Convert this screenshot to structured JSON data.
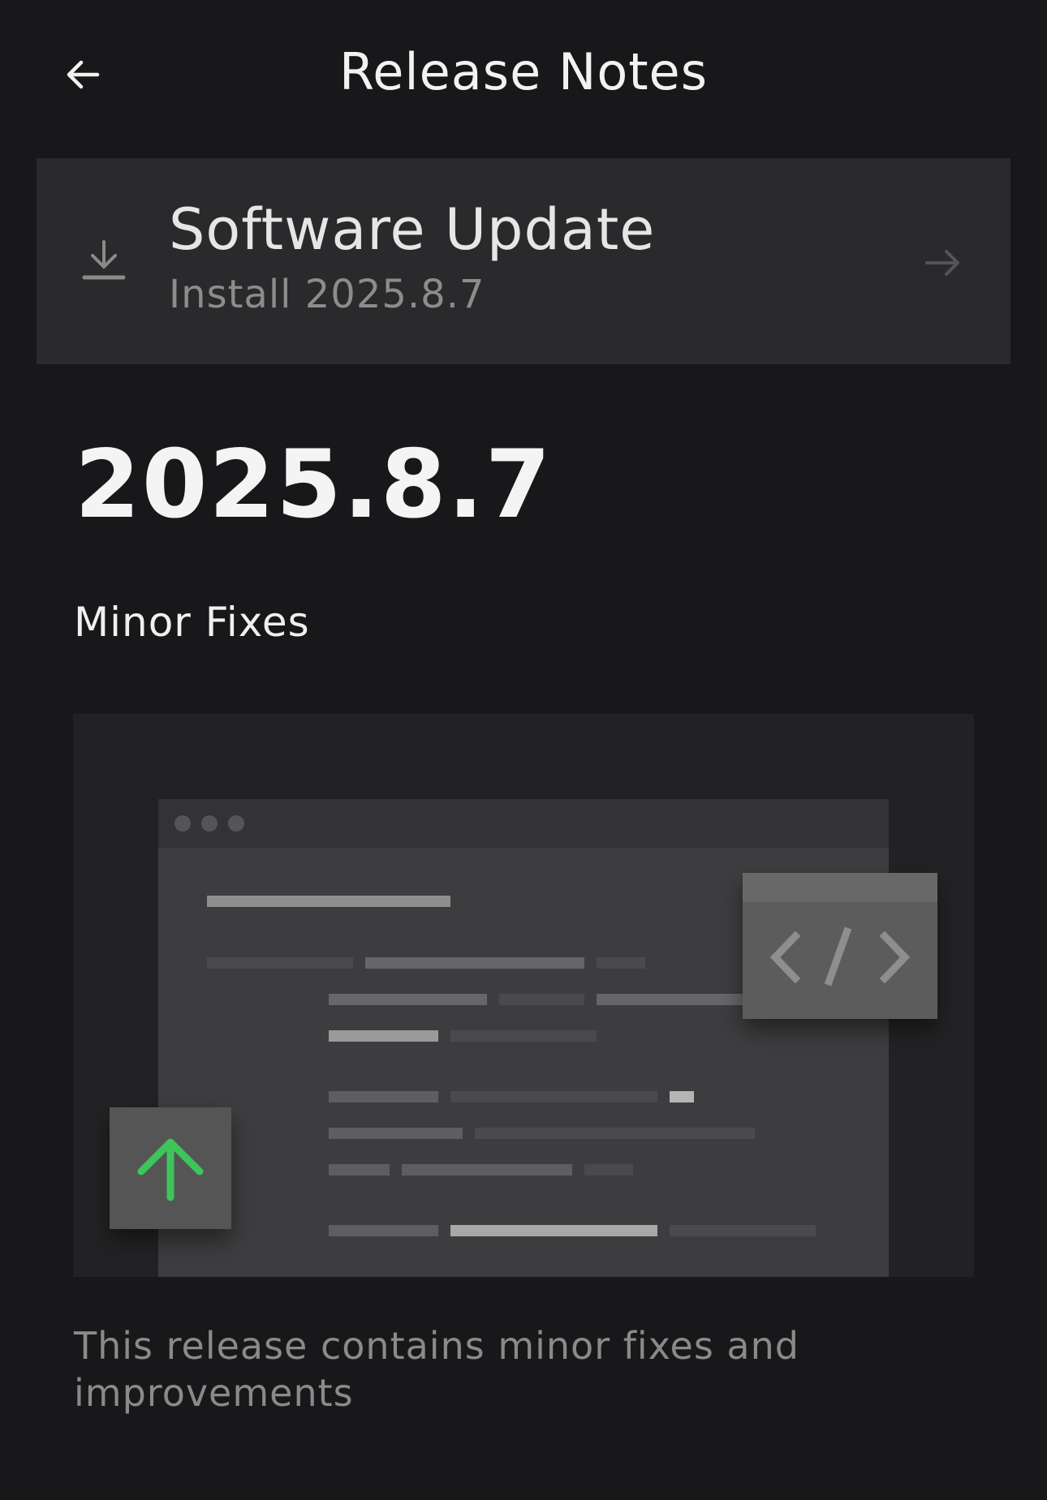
{
  "header": {
    "title": "Release Notes",
    "back_icon": "arrow-left-icon"
  },
  "update_card": {
    "title": "Software Update",
    "subtitle": "Install 2025.8.7",
    "leading_icon": "download-icon",
    "trailing_icon": "arrow-right-icon"
  },
  "release": {
    "version": "2025.8.7",
    "section_title": "Minor Fixes",
    "description": "This release contains minor fixes and improvements"
  },
  "illustration": {
    "code_icon": "code-brackets-icon",
    "upload_icon": "arrow-up-icon"
  },
  "colors": {
    "background": "#18181a",
    "card": "#2a2a2c",
    "accent_green": "#3ec55a"
  }
}
